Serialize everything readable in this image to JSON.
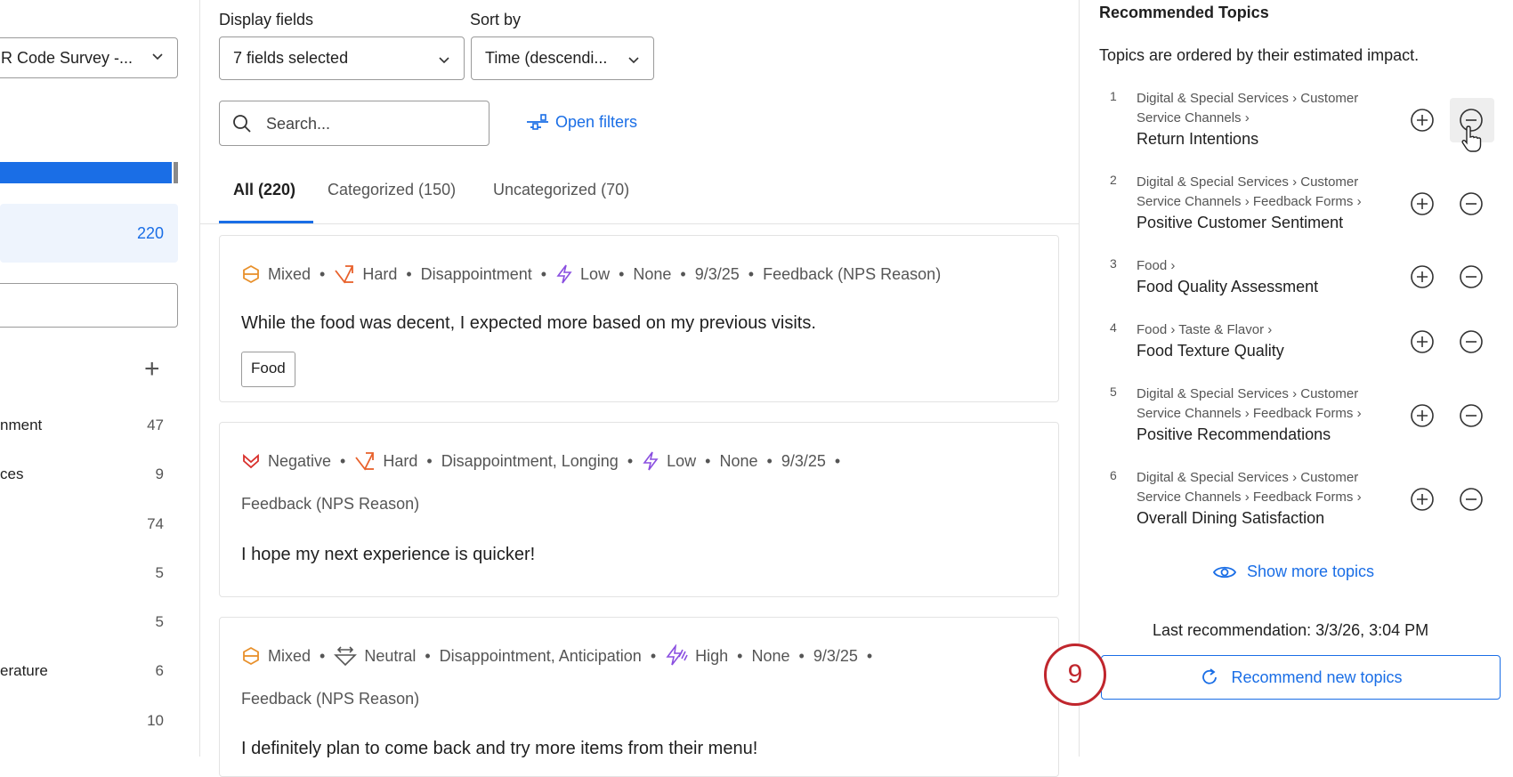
{
  "left": {
    "survey_select": "R Code Survey -...",
    "all_count": "220",
    "topics": [
      {
        "label": "nment",
        "count": "47"
      },
      {
        "label": "ces",
        "count": "9"
      },
      {
        "label": "",
        "count": "74"
      },
      {
        "label": "",
        "count": "5"
      },
      {
        "label": "",
        "count": "5"
      },
      {
        "label": "erature",
        "count": "6"
      },
      {
        "label": "",
        "count": "10"
      }
    ]
  },
  "main": {
    "display_fields_label": "Display fields",
    "display_fields_value": "7 fields selected",
    "sort_by_label": "Sort by",
    "sort_by_value": "Time (descendi...",
    "search_placeholder": "Search...",
    "open_filters": "Open filters",
    "tabs": [
      {
        "label": "All (220)"
      },
      {
        "label": "Categorized (150)"
      },
      {
        "label": "Uncategorized (70)"
      }
    ],
    "cards": [
      {
        "sentiment": "Mixed",
        "effort": "Hard",
        "emotion": "Disappointment",
        "intensity": "Low",
        "other": "None",
        "date": "9/3/25",
        "source": "Feedback (NPS Reason)",
        "text": "While the food was decent, I expected more based on my previous visits.",
        "tag": "Food"
      },
      {
        "sentiment": "Negative",
        "effort": "Hard",
        "emotion": "Disappointment, Longing",
        "intensity": "Low",
        "other": "None",
        "date": "9/3/25",
        "source": "Feedback (NPS Reason)",
        "text": "I hope my next experience is quicker!"
      },
      {
        "sentiment": "Mixed",
        "effort": "Neutral",
        "emotion": "Disappointment, Anticipation",
        "intensity": "High",
        "other": "None",
        "date": "9/3/25",
        "source": "Feedback (NPS Reason)",
        "text": "I definitely plan to come back and try more items from their menu!"
      }
    ]
  },
  "right": {
    "title": "Recommended Topics",
    "subtitle": "Topics are ordered by their estimated impact.",
    "topics": [
      {
        "num": "1",
        "path1": "Digital & Special Services › Customer",
        "path2": "Service Channels ›",
        "name": "Return Intentions"
      },
      {
        "num": "2",
        "path1": "Digital & Special Services › Customer",
        "path2": "Service Channels › Feedback Forms ›",
        "name": "Positive Customer Sentiment"
      },
      {
        "num": "3",
        "path1": "Food ›",
        "path2": "",
        "name": "Food Quality Assessment"
      },
      {
        "num": "4",
        "path1": "Food › Taste & Flavor ›",
        "path2": "",
        "name": "Food Texture Quality"
      },
      {
        "num": "5",
        "path1": "Digital & Special Services › Customer",
        "path2": "Service Channels › Feedback Forms ›",
        "name": "Positive Recommendations"
      },
      {
        "num": "6",
        "path1": "Digital & Special Services › Customer",
        "path2": "Service Channels › Feedback Forms ›",
        "name": "Overall Dining Satisfaction"
      }
    ],
    "show_more": "Show more topics",
    "last_recommendation": "Last recommendation: 3/3/26, 3:04 PM",
    "recommend_button": "Recommend new topics"
  },
  "annotation": {
    "step_number": "9"
  },
  "colors": {
    "accent": "#1a6ee6",
    "annotation": "#c0262d",
    "mixed": "#e8902b",
    "negative": "#d9302c",
    "intensity": "#8a4fe0"
  }
}
